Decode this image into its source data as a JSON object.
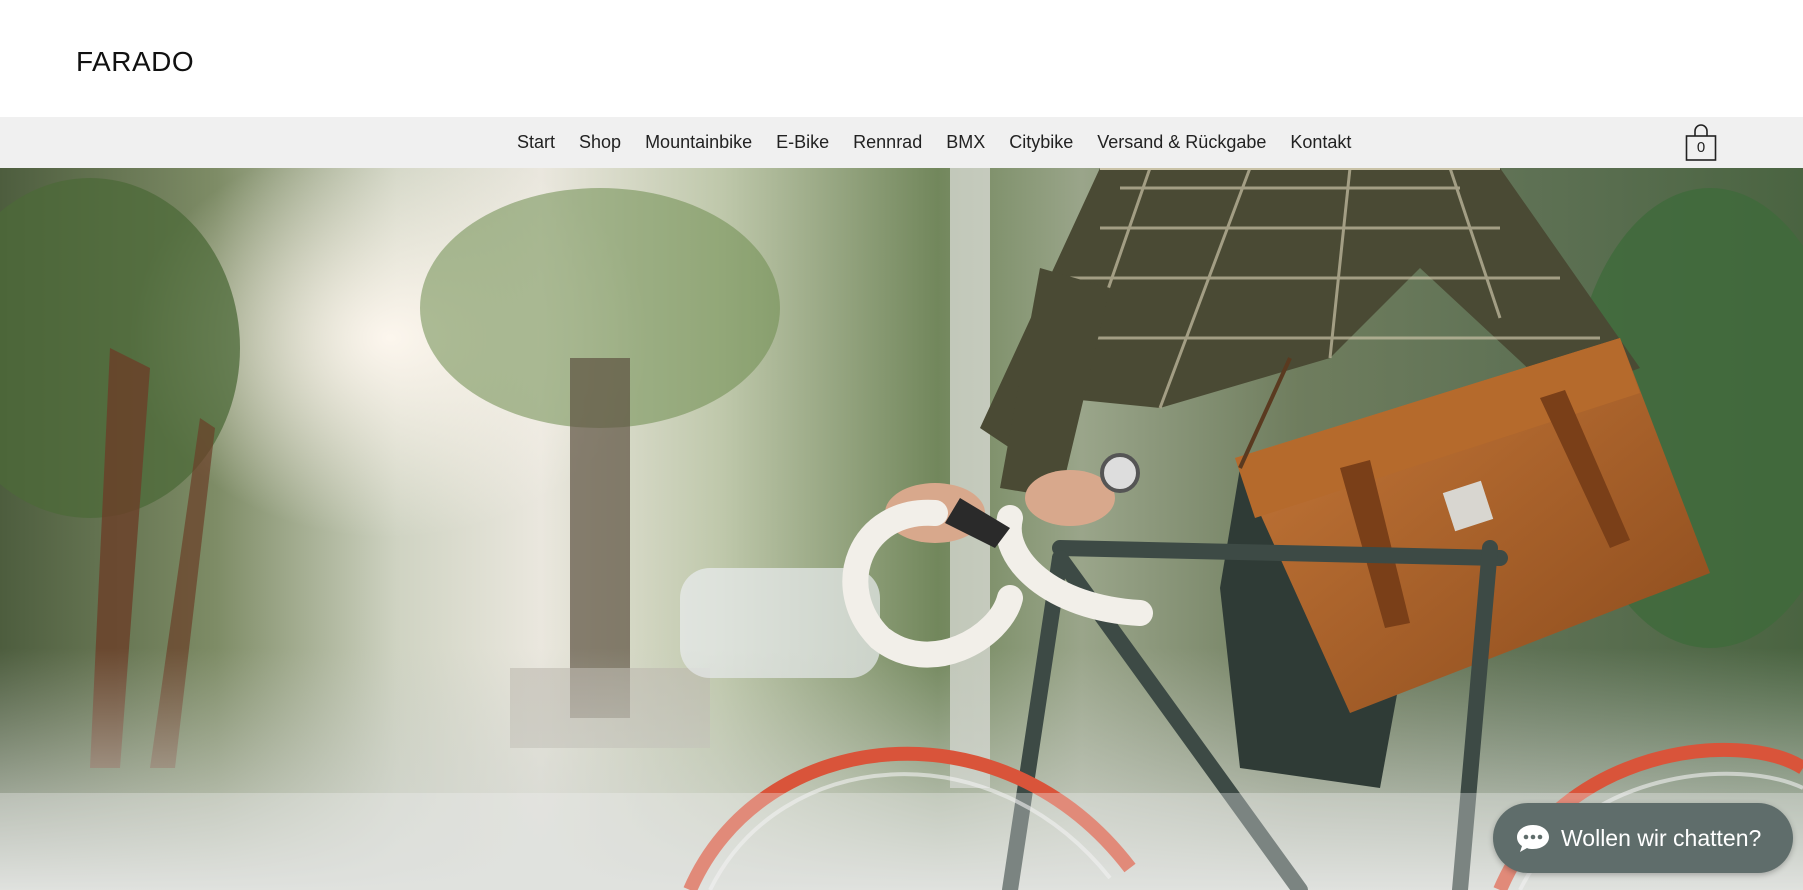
{
  "header": {
    "logo": "FARADO"
  },
  "nav": {
    "items": [
      {
        "label": "Start"
      },
      {
        "label": "Shop"
      },
      {
        "label": "Mountainbike"
      },
      {
        "label": "E-Bike"
      },
      {
        "label": "Rennrad"
      },
      {
        "label": "BMX"
      },
      {
        "label": "Citybike"
      },
      {
        "label": "Versand & Rückgabe"
      },
      {
        "label": "Kontakt"
      }
    ]
  },
  "cart": {
    "icon": "shopping-bag-icon",
    "count": "0"
  },
  "hero": {
    "image": "cyclist-with-leather-briefcase-on-road-bike"
  },
  "chat": {
    "icon": "chat-bubble-icon",
    "label": "Wollen wir chatten?",
    "color": "#5f6d6b"
  }
}
